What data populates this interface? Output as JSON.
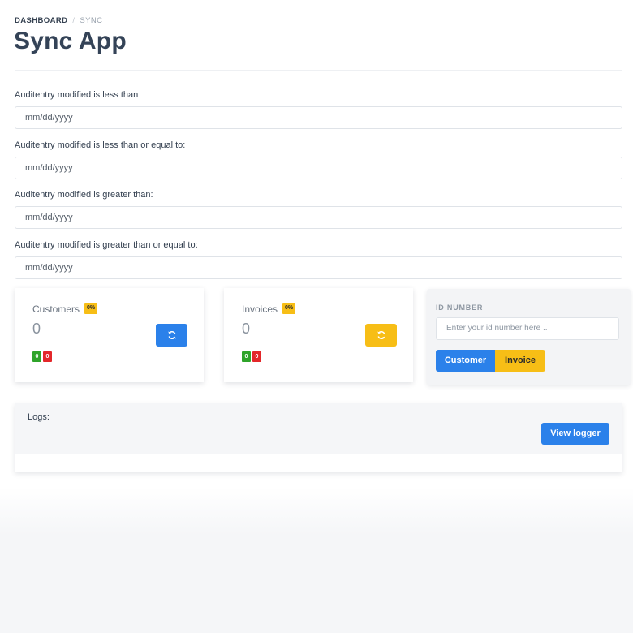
{
  "breadcrumb": {
    "items": [
      "DASHBOARD",
      "SYNC"
    ],
    "separator": "/"
  },
  "page": {
    "title": "Sync App"
  },
  "filters": [
    {
      "label": "Auditentry modified is less than",
      "placeholder": "mm/dd/yyyy"
    },
    {
      "label": "Auditentry modified is less than or equal to:",
      "placeholder": "mm/dd/yyyy"
    },
    {
      "label": "Auditentry modified is greater than:",
      "placeholder": "mm/dd/yyyy"
    },
    {
      "label": "Auditentry modified is greater than or equal to:",
      "placeholder": "mm/dd/yyyy"
    }
  ],
  "cards": {
    "customers": {
      "title": "Customers",
      "percent": "0%",
      "count": "0",
      "success": "0",
      "errors": "0",
      "button_color": "#2b81ea",
      "icon": "sync-icon"
    },
    "invoices": {
      "title": "Invoices",
      "percent": "0%",
      "count": "0",
      "success": "0",
      "errors": "0",
      "button_color": "#f7be16",
      "icon": "sync-icon"
    }
  },
  "id_panel": {
    "label": "ID NUMBER",
    "placeholder": "Enter your id number here ..",
    "customer_button": "Customer",
    "invoice_button": "Invoice"
  },
  "logs": {
    "label": "Logs:",
    "view_button": "View logger"
  },
  "colors": {
    "primary": "#2b81ea",
    "warning": "#f7be16",
    "success": "#2fa42a",
    "danger": "#e3272a",
    "heading": "#344357"
  }
}
